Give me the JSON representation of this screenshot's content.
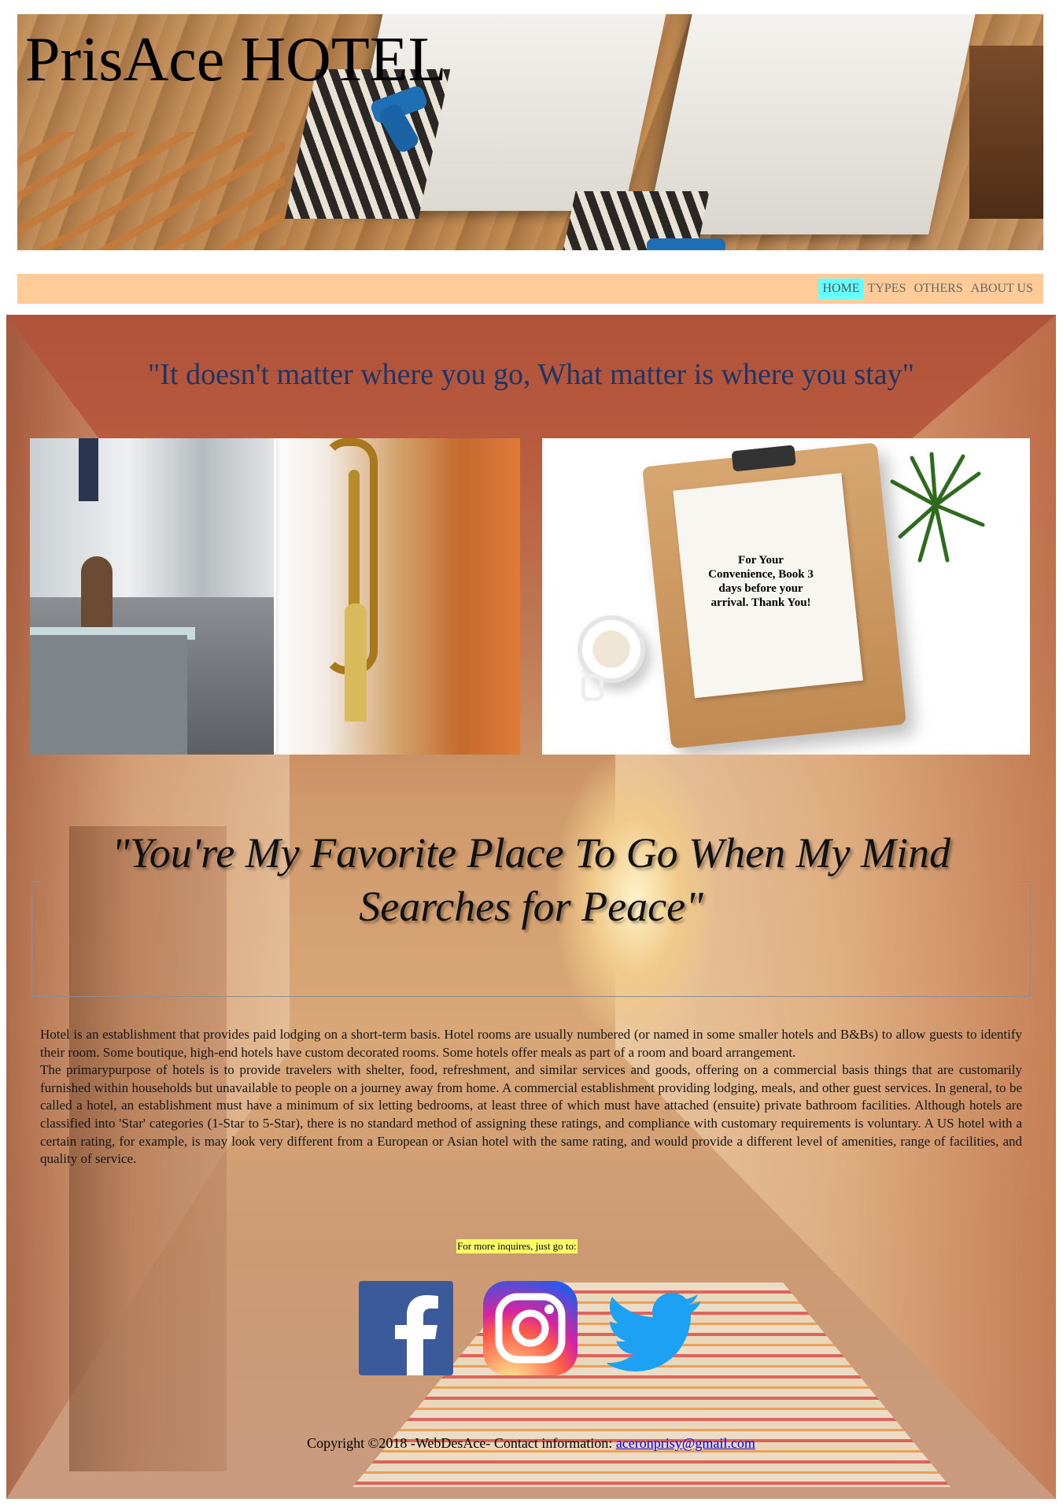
{
  "header": {
    "brand": "PrisAce HOTEL"
  },
  "nav": {
    "items": [
      {
        "label": "HOME",
        "active": true
      },
      {
        "label": "TYPES",
        "active": false
      },
      {
        "label": "OTHERS",
        "active": false
      },
      {
        "label": "ABOUT US",
        "active": false
      }
    ]
  },
  "main": {
    "quote1": "\"It doesn't matter where you go, What matter is where you stay\"",
    "booking_note": "For Your Convenience, Book 3 days before your arrival. Thank You!",
    "quote2": "\"You're My Favorite Place To Go When My Mind Searches for Peace\"",
    "about_p1": "Hotel is an establishment that provides paid lodging on a short-term basis. Hotel rooms are usually numbered (or named in some smaller hotels and B&Bs) to allow guests to identify their room. Some boutique, high-end hotels have custom decorated rooms. Some hotels offer meals as part of a room and board arrangement.",
    "about_p2": "The primarypurpose of hotels is to provide travelers with shelter, food, refreshment, and similar services and goods, offering on a commercial basis things that are customarily furnished within households but unavailable to people on a journey away from home. A commercial establishment providing lodging, meals, and other guest services. In general, to be called a hotel, an establishment must have a minimum of six letting bedrooms, at least three of which must have attached (ensuite) private bathroom facilities. Although hotels are classified into 'Star' categories (1-Star to 5-Star), there is no standard method of assigning these ratings, and compliance with customary requirements is voluntary. A US hotel with a certain rating, for example, is may look very different from a European or Asian hotel with the same rating, and would provide a different level of amenities, range of facilities, and quality of service.",
    "inquire": "For more inquires, just go to:"
  },
  "social": {
    "icons": [
      "facebook-icon",
      "instagram-icon",
      "twitter-icon"
    ]
  },
  "footer": {
    "copyright": "Copyright ©2018 -WebDesAce- Contact information: ",
    "email": "aceronprisy@gmail.com"
  },
  "colors": {
    "nav_bg": "#ffcc99",
    "nav_active": "#66ffff",
    "quote1": "#1e3567",
    "inquire_bg": "#ffff66",
    "facebook": "#3b5a9a",
    "twitter": "#1da1f2"
  }
}
